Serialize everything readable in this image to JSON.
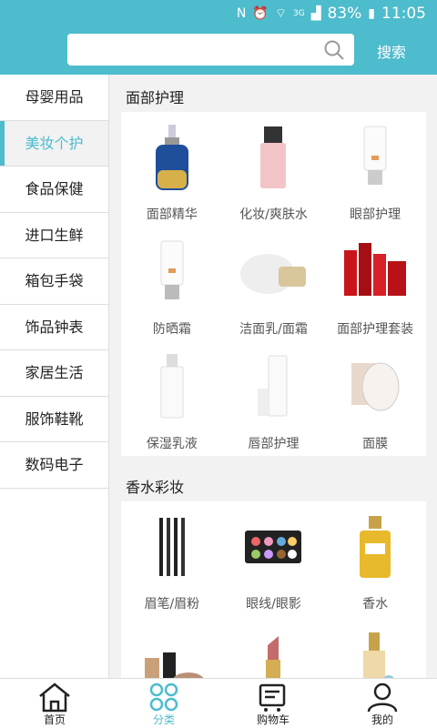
{
  "status_bar": {
    "battery": "83%",
    "time": "11:05",
    "network": "3G"
  },
  "search": {
    "placeholder": "",
    "button_label": "搜索"
  },
  "sidebar": {
    "items": [
      {
        "label": "母婴用品"
      },
      {
        "label": "美妆个护"
      },
      {
        "label": "食品保健"
      },
      {
        "label": "进口生鲜"
      },
      {
        "label": "箱包手袋"
      },
      {
        "label": "饰品钟表"
      },
      {
        "label": "家居生活"
      },
      {
        "label": "服饰鞋靴"
      },
      {
        "label": "数码电子"
      }
    ],
    "active": "美妆个护"
  },
  "sections": [
    {
      "title": "面部护理",
      "items": [
        {
          "label": "面部精华",
          "icon": "serum-bottle-icon"
        },
        {
          "label": "化妆/爽肤水",
          "icon": "toner-bottle-icon"
        },
        {
          "label": "眼部护理",
          "icon": "eye-cream-tube-icon"
        },
        {
          "label": "防晒霜",
          "icon": "sunscreen-tube-icon"
        },
        {
          "label": "洁面乳/面霜",
          "icon": "cream-jar-icon"
        },
        {
          "label": "面部护理套装",
          "icon": "skincare-set-icon"
        },
        {
          "label": "保湿乳液",
          "icon": "lotion-bottle-icon"
        },
        {
          "label": "唇部护理",
          "icon": "lip-care-icon"
        },
        {
          "label": "面膜",
          "icon": "face-mask-icon"
        }
      ]
    },
    {
      "title": "香水彩妆",
      "items": [
        {
          "label": "眉笔/眉粉",
          "icon": "eyebrow-pencil-icon"
        },
        {
          "label": "眼线/眼影",
          "icon": "eyeshadow-palette-icon"
        },
        {
          "label": "香水",
          "icon": "perfume-bottle-icon"
        },
        {
          "label": "",
          "icon": "makeup-set-icon"
        },
        {
          "label": "",
          "icon": "lipstick-icon"
        },
        {
          "label": "",
          "icon": "foundation-bottle-icon"
        }
      ]
    }
  ],
  "tabbar": {
    "items": [
      {
        "label": "首页",
        "icon": "home-icon"
      },
      {
        "label": "分类",
        "icon": "category-icon"
      },
      {
        "label": "购物车",
        "icon": "cart-icon"
      },
      {
        "label": "我的",
        "icon": "user-icon"
      }
    ],
    "active": "分类"
  },
  "colors": {
    "accent": "#4dbccd",
    "background": "#f2f2f2"
  }
}
